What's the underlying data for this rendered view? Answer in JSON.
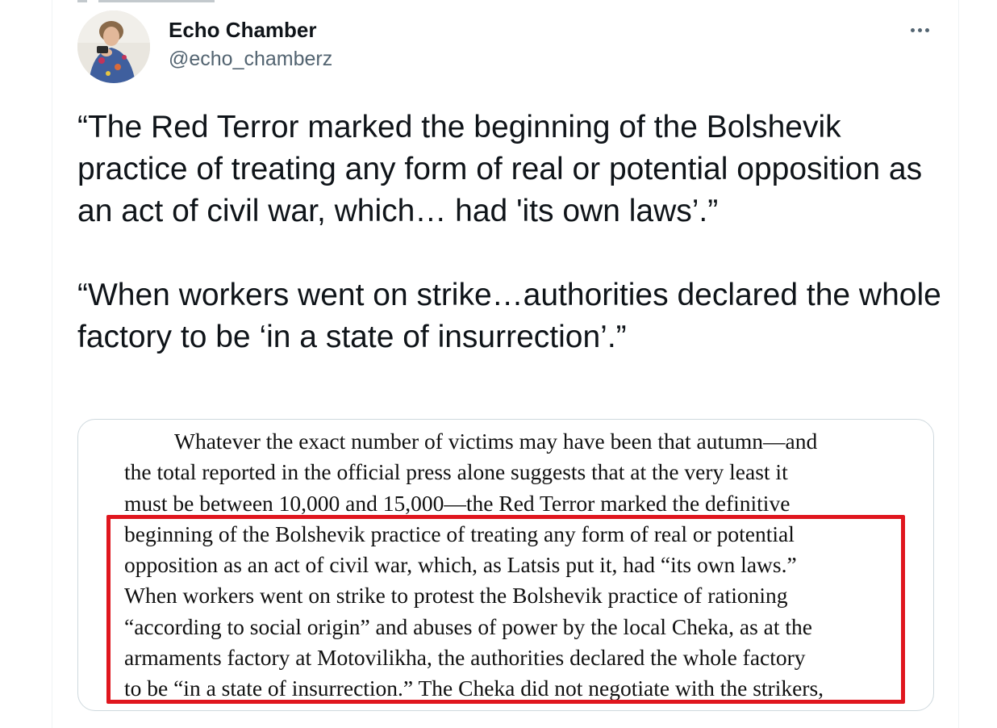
{
  "author": {
    "name": "Echo Chamber",
    "handle": "@echo_chamberz"
  },
  "tweet": {
    "paragraph1": "“The Red Terror marked the beginning  of the Bolshevik practice of treating any form of real or potential opposition as an act of civil war, which… had 'its own laws’.”",
    "paragraph2": "“When workers went on strike…authorities declared the whole factory to be ‘in a state of insurrection’.”"
  },
  "media": {
    "lines": [
      "Whatever the exact number of victims may have been that autumn—and",
      "the total reported in the official press alone suggests that at the very least it",
      "must be between 10,000 and 15,000—the Red Terror marked the definitive",
      "beginning of the Bolshevik practice of treating any form of real or potential",
      "opposition as an act of civil war, which, as Latsis put it, had “its own laws.”",
      "When workers went on strike to protest the Bolshevik practice of rationing",
      "“according to social origin” and abuses of power by the local Cheka, as at the",
      "armaments factory at Motovilikha, the authorities declared the whole factory",
      "to be “in a state of insurrection.” The Cheka did not negotiate with the strikers,"
    ],
    "highlight_color": "#e0161e"
  },
  "icons": {
    "more": "more-horizontal-icon",
    "avatar": "avatar-photo"
  }
}
